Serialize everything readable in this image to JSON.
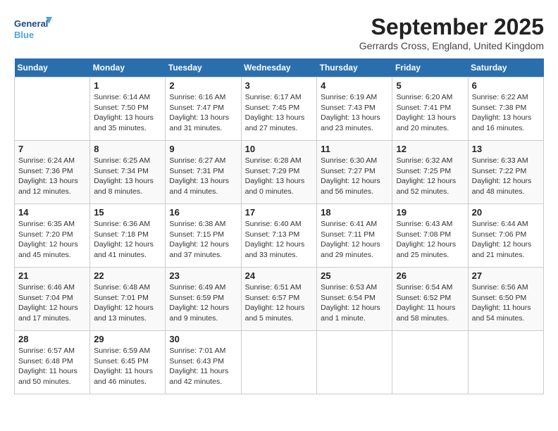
{
  "header": {
    "logo_text_general": "General",
    "logo_text_blue": "Blue",
    "month_title": "September 2025",
    "location": "Gerrards Cross, England, United Kingdom"
  },
  "days_header": [
    "Sunday",
    "Monday",
    "Tuesday",
    "Wednesday",
    "Thursday",
    "Friday",
    "Saturday"
  ],
  "weeks": [
    [
      {
        "day": "",
        "info": ""
      },
      {
        "day": "1",
        "info": "Sunrise: 6:14 AM\nSunset: 7:50 PM\nDaylight: 13 hours\nand 35 minutes."
      },
      {
        "day": "2",
        "info": "Sunrise: 6:16 AM\nSunset: 7:47 PM\nDaylight: 13 hours\nand 31 minutes."
      },
      {
        "day": "3",
        "info": "Sunrise: 6:17 AM\nSunset: 7:45 PM\nDaylight: 13 hours\nand 27 minutes."
      },
      {
        "day": "4",
        "info": "Sunrise: 6:19 AM\nSunset: 7:43 PM\nDaylight: 13 hours\nand 23 minutes."
      },
      {
        "day": "5",
        "info": "Sunrise: 6:20 AM\nSunset: 7:41 PM\nDaylight: 13 hours\nand 20 minutes."
      },
      {
        "day": "6",
        "info": "Sunrise: 6:22 AM\nSunset: 7:38 PM\nDaylight: 13 hours\nand 16 minutes."
      }
    ],
    [
      {
        "day": "7",
        "info": "Sunrise: 6:24 AM\nSunset: 7:36 PM\nDaylight: 13 hours\nand 12 minutes."
      },
      {
        "day": "8",
        "info": "Sunrise: 6:25 AM\nSunset: 7:34 PM\nDaylight: 13 hours\nand 8 minutes."
      },
      {
        "day": "9",
        "info": "Sunrise: 6:27 AM\nSunset: 7:31 PM\nDaylight: 13 hours\nand 4 minutes."
      },
      {
        "day": "10",
        "info": "Sunrise: 6:28 AM\nSunset: 7:29 PM\nDaylight: 13 hours\nand 0 minutes."
      },
      {
        "day": "11",
        "info": "Sunrise: 6:30 AM\nSunset: 7:27 PM\nDaylight: 12 hours\nand 56 minutes."
      },
      {
        "day": "12",
        "info": "Sunrise: 6:32 AM\nSunset: 7:25 PM\nDaylight: 12 hours\nand 52 minutes."
      },
      {
        "day": "13",
        "info": "Sunrise: 6:33 AM\nSunset: 7:22 PM\nDaylight: 12 hours\nand 48 minutes."
      }
    ],
    [
      {
        "day": "14",
        "info": "Sunrise: 6:35 AM\nSunset: 7:20 PM\nDaylight: 12 hours\nand 45 minutes."
      },
      {
        "day": "15",
        "info": "Sunrise: 6:36 AM\nSunset: 7:18 PM\nDaylight: 12 hours\nand 41 minutes."
      },
      {
        "day": "16",
        "info": "Sunrise: 6:38 AM\nSunset: 7:15 PM\nDaylight: 12 hours\nand 37 minutes."
      },
      {
        "day": "17",
        "info": "Sunrise: 6:40 AM\nSunset: 7:13 PM\nDaylight: 12 hours\nand 33 minutes."
      },
      {
        "day": "18",
        "info": "Sunrise: 6:41 AM\nSunset: 7:11 PM\nDaylight: 12 hours\nand 29 minutes."
      },
      {
        "day": "19",
        "info": "Sunrise: 6:43 AM\nSunset: 7:08 PM\nDaylight: 12 hours\nand 25 minutes."
      },
      {
        "day": "20",
        "info": "Sunrise: 6:44 AM\nSunset: 7:06 PM\nDaylight: 12 hours\nand 21 minutes."
      }
    ],
    [
      {
        "day": "21",
        "info": "Sunrise: 6:46 AM\nSunset: 7:04 PM\nDaylight: 12 hours\nand 17 minutes."
      },
      {
        "day": "22",
        "info": "Sunrise: 6:48 AM\nSunset: 7:01 PM\nDaylight: 12 hours\nand 13 minutes."
      },
      {
        "day": "23",
        "info": "Sunrise: 6:49 AM\nSunset: 6:59 PM\nDaylight: 12 hours\nand 9 minutes."
      },
      {
        "day": "24",
        "info": "Sunrise: 6:51 AM\nSunset: 6:57 PM\nDaylight: 12 hours\nand 5 minutes."
      },
      {
        "day": "25",
        "info": "Sunrise: 6:53 AM\nSunset: 6:54 PM\nDaylight: 12 hours\nand 1 minute."
      },
      {
        "day": "26",
        "info": "Sunrise: 6:54 AM\nSunset: 6:52 PM\nDaylight: 11 hours\nand 58 minutes."
      },
      {
        "day": "27",
        "info": "Sunrise: 6:56 AM\nSunset: 6:50 PM\nDaylight: 11 hours\nand 54 minutes."
      }
    ],
    [
      {
        "day": "28",
        "info": "Sunrise: 6:57 AM\nSunset: 6:48 PM\nDaylight: 11 hours\nand 50 minutes."
      },
      {
        "day": "29",
        "info": "Sunrise: 6:59 AM\nSunset: 6:45 PM\nDaylight: 11 hours\nand 46 minutes."
      },
      {
        "day": "30",
        "info": "Sunrise: 7:01 AM\nSunset: 6:43 PM\nDaylight: 11 hours\nand 42 minutes."
      },
      {
        "day": "",
        "info": ""
      },
      {
        "day": "",
        "info": ""
      },
      {
        "day": "",
        "info": ""
      },
      {
        "day": "",
        "info": ""
      }
    ]
  ]
}
